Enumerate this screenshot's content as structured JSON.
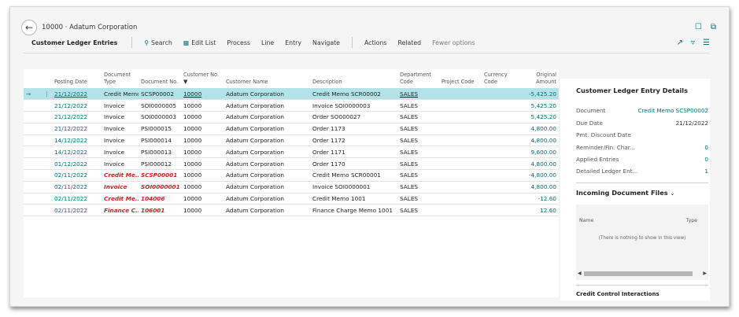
{
  "page": {
    "title": "10000 · Adatum Corporation"
  },
  "actionbar": {
    "caption": "Customer Ledger Entries",
    "search": "Search",
    "edit_list": "Edit List",
    "process": "Process",
    "line": "Line",
    "entry": "Entry",
    "navigate": "Navigate",
    "actions": "Actions",
    "related": "Related",
    "fewer_options": "Fewer options"
  },
  "table": {
    "headers": {
      "posting_date": "Posting Date",
      "document_type": "Document Type",
      "document_no": "Document No.",
      "customer_no": "Customer No.",
      "customer_name": "Customer Name",
      "description": "Description",
      "department_code": "Department Code",
      "project_code": "Project Code",
      "currency_code": "Currency Code",
      "original_amount": "Original Amount"
    },
    "rows": [
      {
        "date": "21/12/2022",
        "type": "Credit Memo",
        "doc": "SCSP00002",
        "cust": "10000",
        "name": "Adatum Corporation",
        "desc": "Credit Memo SCR00002",
        "dept": "SALES",
        "proj": "",
        "cur": "",
        "amt": "-5,425.20"
      },
      {
        "date": "21/12/2022",
        "type": "Invoice",
        "doc": "SOI0000005",
        "cust": "10000",
        "name": "Adatum Corporation",
        "desc": "Invoice SOI0000003",
        "dept": "SALES",
        "proj": "",
        "cur": "",
        "amt": "5,425.20"
      },
      {
        "date": "21/12/2022",
        "type": "Invoice",
        "doc": "SOI0000003",
        "cust": "10000",
        "name": "Adatum Corporation",
        "desc": "Order SO000027",
        "dept": "SALES",
        "proj": "",
        "cur": "",
        "amt": "5,425.20"
      },
      {
        "date": "21/12/2022",
        "type": "Invoice",
        "doc": "PSI000015",
        "cust": "10000",
        "name": "Adatum Corporation",
        "desc": "Order 1173",
        "dept": "SALES",
        "proj": "",
        "cur": "",
        "amt": "4,800.00"
      },
      {
        "date": "14/12/2022",
        "type": "Invoice",
        "doc": "PSI000014",
        "cust": "10000",
        "name": "Adatum Corporation",
        "desc": "Order 1172",
        "dept": "SALES",
        "proj": "",
        "cur": "",
        "amt": "4,800.00"
      },
      {
        "date": "14/12/2022",
        "type": "Invoice",
        "doc": "PSI000013",
        "cust": "10000",
        "name": "Adatum Corporation",
        "desc": "Order 1171",
        "dept": "SALES",
        "proj": "",
        "cur": "",
        "amt": "9,600.00"
      },
      {
        "date": "01/12/2022",
        "type": "Invoice",
        "doc": "PSI000012",
        "cust": "10000",
        "name": "Adatum Corporation",
        "desc": "Order 1170",
        "dept": "SALES",
        "proj": "",
        "cur": "",
        "amt": "4,800.00"
      },
      {
        "date": "02/11/2022",
        "type": "Credit Me...",
        "doc": "SCSP00001",
        "cust": "10000",
        "name": "Adatum Corporation",
        "desc": "Credit Memo SCR00001",
        "dept": "SALES",
        "proj": "",
        "cur": "",
        "amt": "-4,800.00"
      },
      {
        "date": "02/11/2022",
        "type": "Invoice",
        "doc": "SOI0000001",
        "cust": "10000",
        "name": "Adatum Corporation",
        "desc": "Invoice SOI0000001",
        "dept": "SALES",
        "proj": "",
        "cur": "",
        "amt": "4,800.00"
      },
      {
        "date": "02/11/2022",
        "type": "Credit Me...",
        "doc": "104006",
        "cust": "10000",
        "name": "Adatum Corporation",
        "desc": "Credit Memo 1001",
        "dept": "SALES",
        "proj": "",
        "cur": "",
        "amt": "-12.60"
      },
      {
        "date": "02/11/2022",
        "type": "Finance C...",
        "doc": "106001",
        "cust": "10000",
        "name": "Adatum Corporation",
        "desc": "Finance Charge Memo 1001",
        "dept": "SALES",
        "proj": "",
        "cur": "",
        "amt": "12.60"
      }
    ]
  },
  "factbox": {
    "title": "Customer Ledger Entry Details",
    "document_label": "Document",
    "document_value": "Credit Memo SCSP00002",
    "due_date_label": "Due Date",
    "due_date_value": "21/12/2022",
    "pmt_discount_label": "Pmt. Discount Date",
    "pmt_discount_value": "",
    "reminder_label": "Reminder/Fin. Char...",
    "reminder_value": "0",
    "applied_label": "Applied Entries",
    "applied_value": "0",
    "detailed_label": "Detailed Ledger Ent...",
    "detailed_value": "1",
    "incoming_title": "Incoming Document Files",
    "incoming_name_header": "Name",
    "incoming_type_header": "Type",
    "incoming_empty": "(There is nothing to show in this view)",
    "next_section": "Credit Control Interactions"
  },
  "colors": {
    "accent": "#00707a",
    "selected_row": "#b3e3e8",
    "overdue_red": "#cc1f1f"
  }
}
